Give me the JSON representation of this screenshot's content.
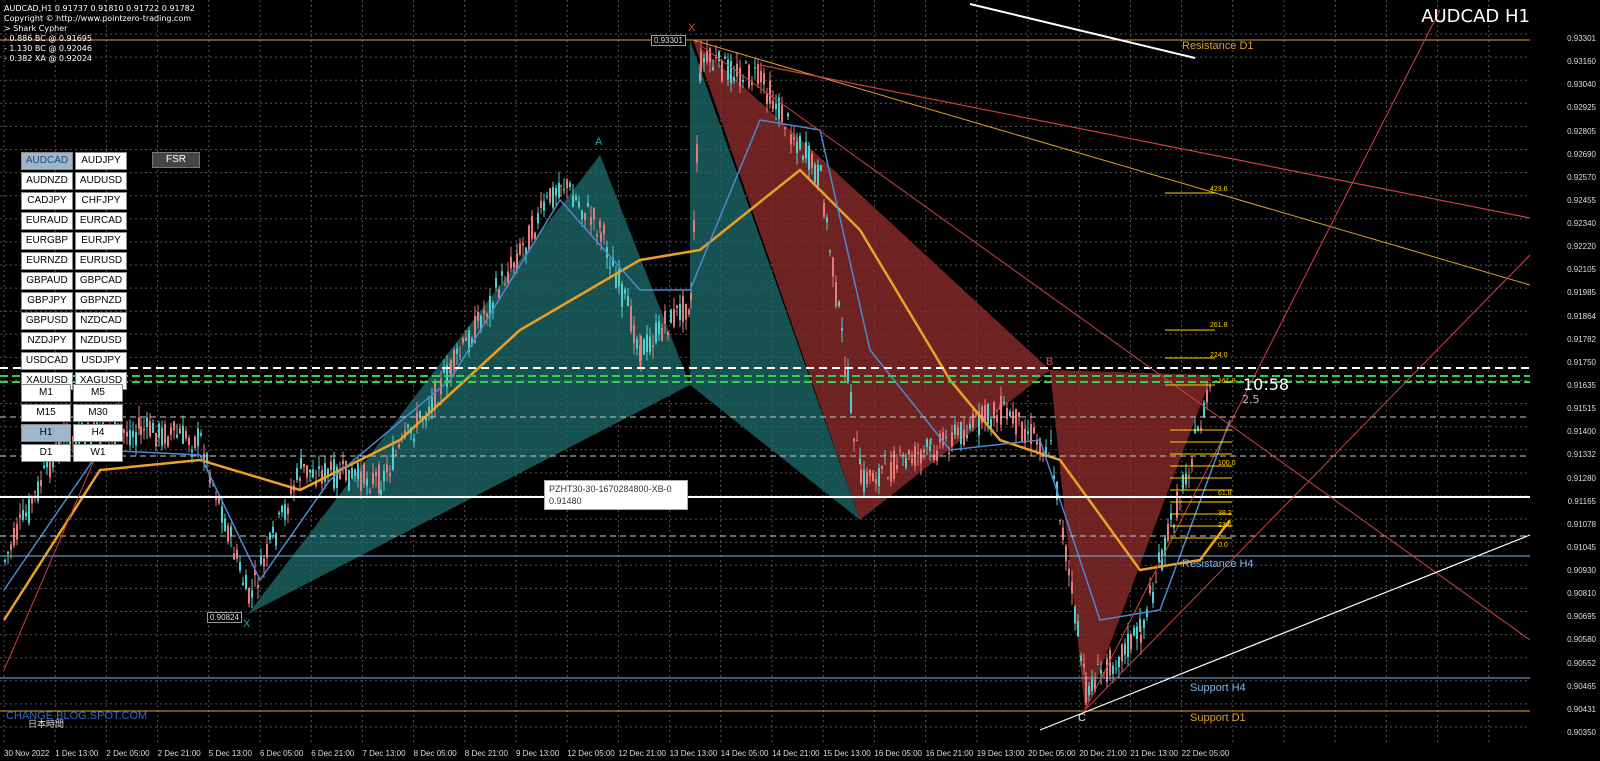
{
  "window": {
    "symbol_title": "AUDCAD H1",
    "ohlc_line": "AUDCAD,H1  0.91737 0.91810 0.91722 0.91782",
    "info_lines": [
      "Copyright © http://www.pointzero-trading.com",
      "> Shark Cypher",
      "- 0.886 BC @ 0.91695",
      "- 1.130 BC @ 0.92046",
      "- 0.382 XA @ 0.92024"
    ]
  },
  "symbols": [
    "AUDCAD",
    "AUDJPY",
    "AUDNZD",
    "AUDUSD",
    "CADJPY",
    "CHFJPY",
    "EURAUD",
    "EURCAD",
    "EURGBP",
    "EURJPY",
    "EURNZD",
    "EURUSD",
    "GBPAUD",
    "GBPCAD",
    "GBPJPY",
    "GBPNZD",
    "GBPUSD",
    "NZDCAD",
    "NZDJPY",
    "NZDUSD",
    "USDCAD",
    "USDJPY",
    "XAUUSD",
    "XAGUSD"
  ],
  "active_symbol": "AUDCAD",
  "fsr_label": "FSR",
  "timeframes": [
    "M1",
    "M5",
    "M15",
    "M30",
    "H1",
    "H4",
    "D1",
    "W1"
  ],
  "active_timeframe": "H1",
  "tooltip": {
    "title": "PZHT30-30-1670284800-XB-0",
    "value": "0.91480"
  },
  "price_axis": [
    "0.93301",
    "0.93160",
    "0.93040",
    "0.92925",
    "0.92805",
    "0.92690",
    "0.92570",
    "0.92455",
    "0.92340",
    "0.92220",
    "0.92105",
    "0.91985",
    "0.91864",
    "0.91782",
    "0.91750",
    "0.91635",
    "0.91515",
    "0.91400",
    "0.91332",
    "0.91280",
    "0.91165",
    "0.91078",
    "0.91045",
    "0.90930",
    "0.90810",
    "0.90695",
    "0.90580",
    "0.90552",
    "0.90465",
    "0.90431",
    "0.90350"
  ],
  "time_axis": [
    "30 Nov 2022",
    "1 Dec 13:00",
    "2 Dec 05:00",
    "2 Dec 21:00",
    "5 Dec 13:00",
    "6 Dec 05:00",
    "6 Dec 21:00",
    "7 Dec 13:00",
    "8 Dec 05:00",
    "8 Dec 21:00",
    "9 Dec 13:00",
    "12 Dec 05:00",
    "12 Dec 21:00",
    "13 Dec 13:00",
    "14 Dec 05:00",
    "14 Dec 21:00",
    "15 Dec 13:00",
    "16 Dec 05:00",
    "16 Dec 21:00",
    "19 Dec 13:00",
    "20 Dec 05:00",
    "20 Dec 21:00",
    "21 Dec 13:00",
    "22 Dec 05:00"
  ],
  "levels": {
    "resistance_d1": "Resistance D1",
    "resistance_h4": "Resistance H4",
    "support_h4": "Support H4",
    "support_d1": "Support D1"
  },
  "point_labels": {
    "x": "X",
    "a": "A",
    "b": "B",
    "c": "C",
    "x2": "X"
  },
  "box_labels": {
    "top_price": "0.93301",
    "low_price": "0.90824"
  },
  "counter": {
    "big": "10:58",
    "small": "2.5"
  },
  "fib_levels": [
    "423.6",
    "261.8",
    "224.0",
    "161.8",
    "100.0",
    "61.8",
    "38.2",
    "23.6",
    "0.0"
  ],
  "watermark": "CHANGE BLOG.SPOT.COM",
  "watermark_sub": "日本時間",
  "colors": {
    "resistance": "#e0a030",
    "support": "#7fb8e8",
    "teal_fill": "#1f6e6e",
    "red_fill": "#8a2a2a",
    "ma_orange": "#f0a020",
    "ma_blue": "#4a8ad0",
    "green_dash": "#2fd04f"
  }
}
